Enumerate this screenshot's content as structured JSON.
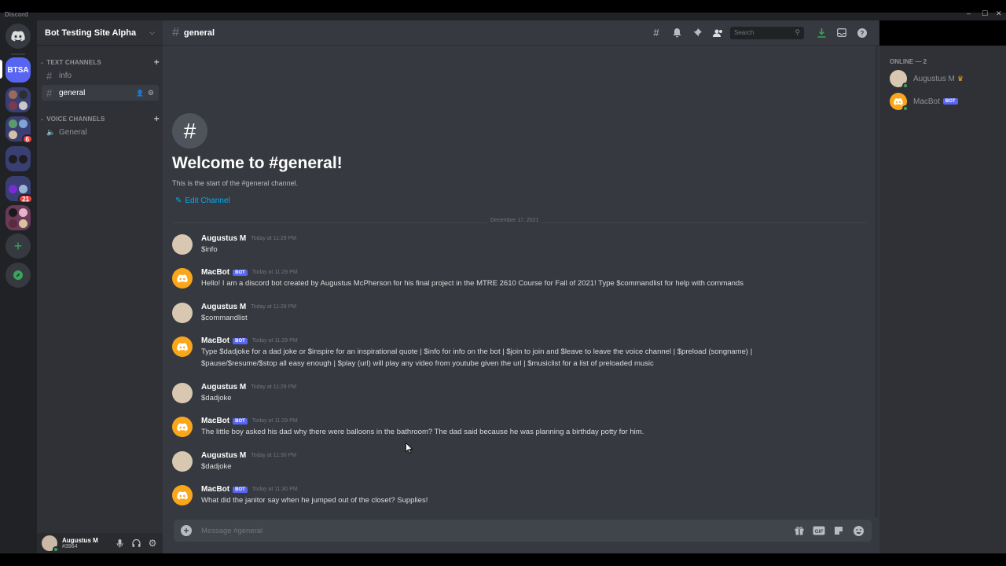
{
  "window": {
    "app_name": "Discord"
  },
  "servers": {
    "current_abbrev": "BTSA",
    "badges": [
      "6",
      "21"
    ]
  },
  "sidebar": {
    "guild_name": "Bot Testing Site Alpha",
    "text_category": "TEXT CHANNELS",
    "voice_category": "VOICE CHANNELS",
    "text_channels": [
      "info",
      "general"
    ],
    "voice_channels": [
      "General"
    ]
  },
  "user_panel": {
    "name": "Augustus M",
    "tag": "#3964"
  },
  "header": {
    "channel": "general",
    "search_placeholder": "Search"
  },
  "welcome": {
    "icon": "#",
    "title": "Welcome to #general!",
    "subtitle": "This is the start of the #general channel.",
    "edit_label": "Edit Channel"
  },
  "date_divider": "December 17, 2021",
  "messages": [
    {
      "author": "Augustus M",
      "bot": false,
      "time": "Today at 11:29 PM",
      "text": "$info"
    },
    {
      "author": "MacBot",
      "bot": true,
      "time": "Today at 11:29 PM",
      "text": "Hello! I am a discord bot created by Augustus McPherson for his final project in the MTRE 2610 Course for Fall of 2021! Type $commandlist for help with commands"
    },
    {
      "author": "Augustus M",
      "bot": false,
      "time": "Today at 11:29 PM",
      "text": "$commandlist"
    },
    {
      "author": "MacBot",
      "bot": true,
      "time": "Today at 11:29 PM",
      "text": "Type $dadjoke for a dad joke or $inspire for an inspirational quote | $info for info on the bot | $join to join and $leave to leave the voice channel | $preload (songname) | $pause/$resume/$stop all easy enough | $play (url) will play any video from youtube given the url | $musiclist for a list of preloaded music"
    },
    {
      "author": "Augustus M",
      "bot": false,
      "time": "Today at 11:29 PM",
      "text": "$dadjoke"
    },
    {
      "author": "MacBot",
      "bot": true,
      "time": "Today at 11:29 PM",
      "text": "The little boy asked his dad why there were balloons in the bathroom? The dad said because he was planning a birthday potty for him."
    },
    {
      "author": "Augustus M",
      "bot": false,
      "time": "Today at 11:30 PM",
      "text": "$dadjoke"
    },
    {
      "author": "MacBot",
      "bot": true,
      "time": "Today at 11:30 PM",
      "text": "What did the janitor say when he jumped out of the closet? Supplies!"
    }
  ],
  "bot_badge": "BOT",
  "composer": {
    "placeholder": "Message #general"
  },
  "members": {
    "category": "ONLINE — 2",
    "list": [
      {
        "name": "Augustus M"
      },
      {
        "name": "MacBot"
      }
    ]
  },
  "colors": {
    "accent": "#5865f2",
    "bot_avatar": "#faa61a",
    "online": "#3ba55d",
    "link": "#00aff4"
  }
}
